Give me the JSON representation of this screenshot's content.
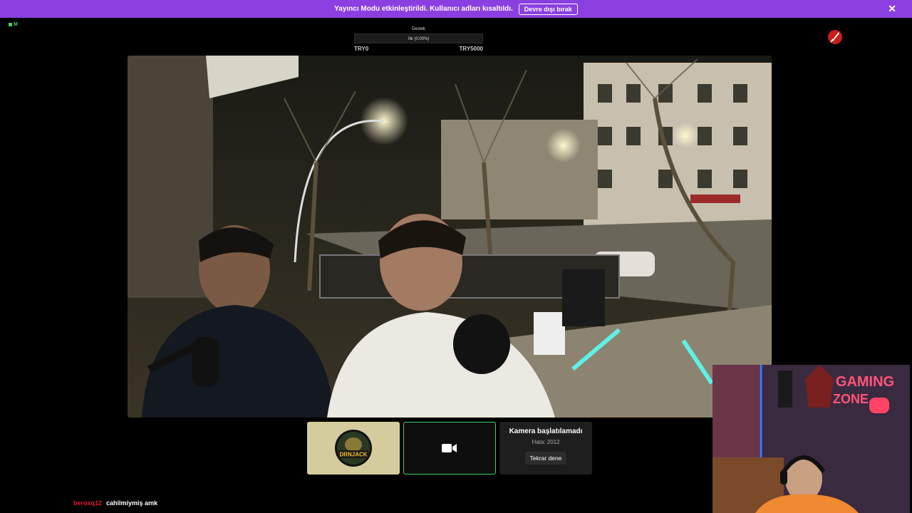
{
  "banner": {
    "message": "Yayıncı Modu etkinleştirildi. Kullanıcı adları kısaltıldı.",
    "button_label": "Devre dışı bırak",
    "close_symbol": "✕",
    "color": "#8b3fe0"
  },
  "status": {
    "live_label": "M"
  },
  "goal": {
    "title": "Destek",
    "progress_text": "0₺ (0.00%)",
    "progress_fraction": 0.0,
    "min_label": "TRY0",
    "max_label": "TRY5000"
  },
  "tiles": {
    "avatar_logo_text": "DRNJACK",
    "camera_icon": "video-camera-icon",
    "error_title": "Kamera başlatılamadı",
    "error_code": "Hata: 2012",
    "retry_label": "Tekrar dene"
  },
  "cam_overlay": {
    "neon_line1": "GAMING",
    "neon_line2": "ZONE"
  },
  "chat": {
    "username": "beroxq12",
    "message": "cahilmiymiş amk"
  },
  "colors": {
    "accent_green": "#3fcf5a",
    "chat_user": "#e01a2f"
  }
}
